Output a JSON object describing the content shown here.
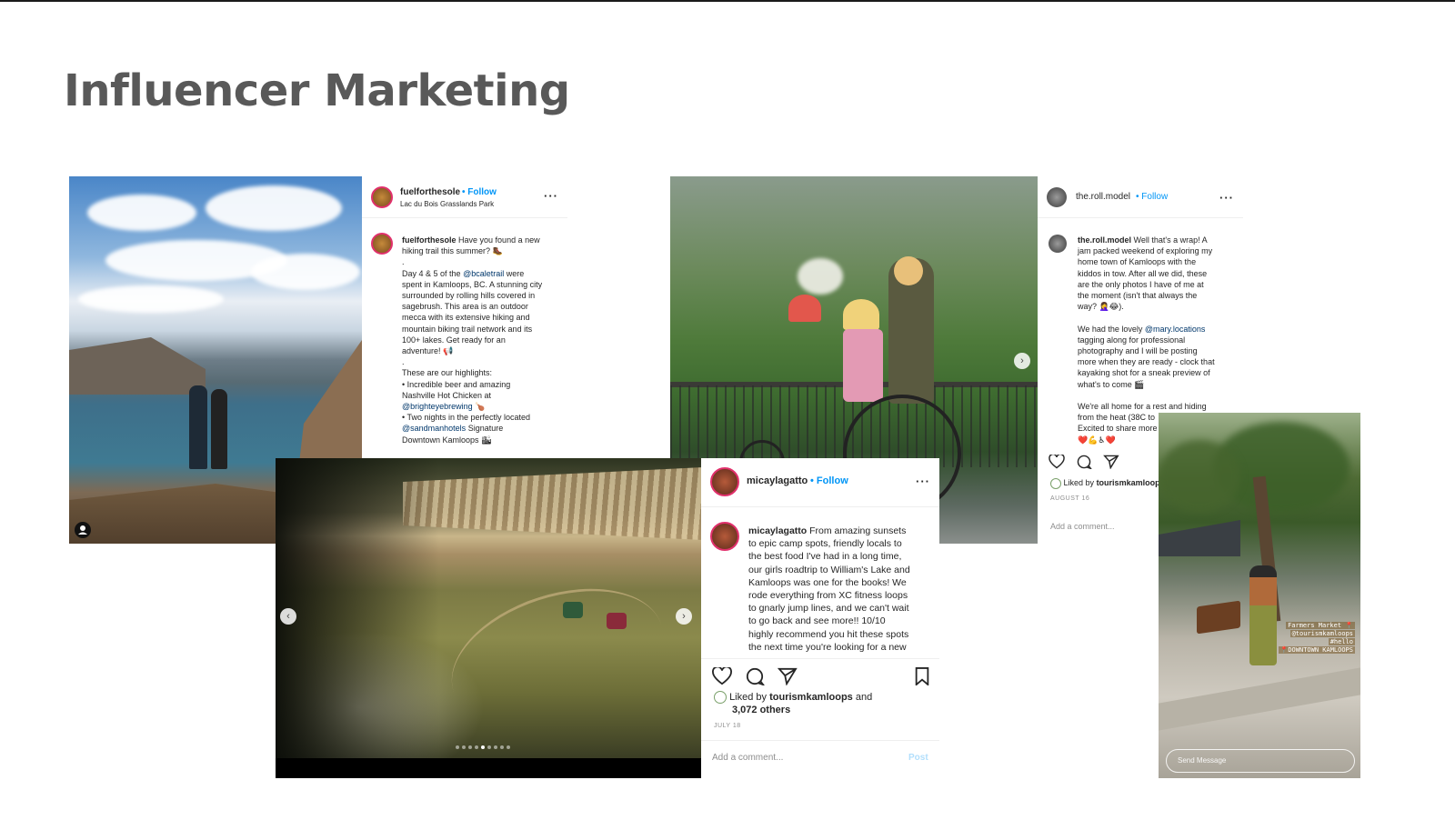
{
  "slide": {
    "title": "Influencer Marketing"
  },
  "post1": {
    "username": "fuelforthesole",
    "follow": "Follow",
    "location": "Lac du Bois Grasslands Park",
    "more": "···",
    "caption_lines": [
      "Have you found a new",
      "hiking trail this summer? 🥾",
      ".",
      "Day 4 & 5 of the",
      "spent in Kamloops, BC. A stunning city",
      "surrounded by rolling hills covered in",
      "sagebrush. This area is an outdoor",
      "mecca with its extensive hiking and",
      "mountain biking trail network and its",
      "100+ lakes. Get ready for an",
      "adventure! 📢",
      ".",
      "These are our highlights:",
      "• Incredible beer and amazing",
      "Nashville Hot Chicken at",
      "🍗",
      "• Two nights in the perfectly located",
      "Signature",
      "Downtown Kamloops 🏙"
    ],
    "mentions": {
      "trail": "@bcaletrail",
      "brewery": "@brighteyebrewing",
      "hotel": "@sandmanhotels"
    },
    "trail_suffix": "were"
  },
  "post2": {
    "username": "the.roll.model",
    "follow": "Follow",
    "more": "···",
    "caption_lines": [
      "Well that's a wrap! A",
      "jam packed weekend of exploring my",
      "home town of Kamloops with the",
      "kiddos in tow. After all we did, these",
      "are the only photos I have of me at",
      "the moment (isn't that always the",
      "way? 🤦‍♀️😂)."
    ],
    "caption_lines_2": [
      "We had the lovely",
      "tagging along for professional",
      "photography and I will be posting",
      "more when they are ready - clock that",
      "kayaking shot for a sneak preview of",
      "what's to come 🎬"
    ],
    "mention": "@mary.locations",
    "caption_lines_3": [
      "We're all home for a rest and hiding",
      "from the heat (38C to",
      "Excited to share more",
      "❤️💪♿❤️"
    ],
    "liked_by": "Liked by",
    "liked_user": "tourismkamloop",
    "date": "AUGUST 16",
    "add_comment": "Add a comment..."
  },
  "post3": {
    "username": "micaylagatto",
    "follow": "Follow",
    "more": "···",
    "caption_lines": [
      "From amazing sunsets",
      "to epic camp spots, friendly locals to",
      "the best food I've had in a long time,",
      "our girls roadtrip to William's Lake and",
      "Kamloops was one for the books! We",
      "rode everything from XC fitness loops",
      "to gnarly jump lines, and we can't wait",
      "to go back and see more!! 10/10",
      "highly recommend you hit these spots",
      "the next time you're looking for a new"
    ],
    "liked_by": "Liked by",
    "liked_user": "tourismkamloops",
    "liked_rest": "and",
    "liked_others": "3,072 others",
    "date": "JULY 18",
    "add_comment": "Add a comment...",
    "post_btn": "Post",
    "carousel_count": 9,
    "carousel_active": 5
  },
  "story": {
    "sticker_line1": "Farmers Market 📍",
    "sticker_line2": "@tourismkamloops",
    "sticker_line3": "#hello",
    "sticker_line4": "📍DOWNTOWN KAMLOOPS",
    "send_message": "Send Message"
  },
  "colors": {
    "follow": "#0095f6",
    "mention": "#00376b",
    "title": "#595959",
    "muted": "#8e8e8e"
  }
}
